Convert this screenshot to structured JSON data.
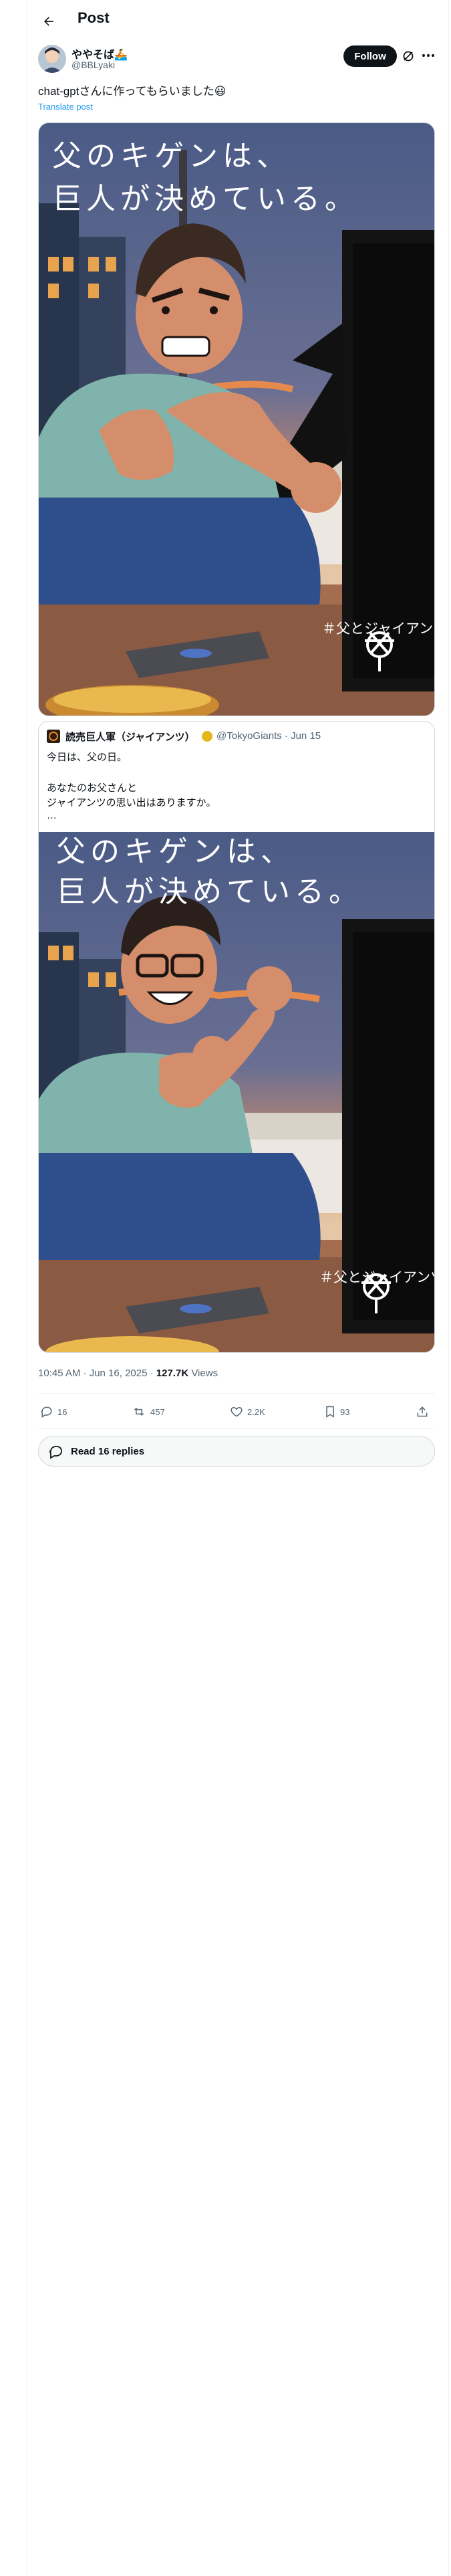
{
  "header": {
    "title": "Post"
  },
  "post": {
    "author": {
      "display_name": "ややそば🚣",
      "handle": "@BBLyaki"
    },
    "follow_label": "Follow",
    "text": "chat-gptさんに作ってもらいました😃",
    "translate_label": "Translate post",
    "image": {
      "caption_line1": "父のキゲンは、",
      "caption_line2": "巨人が決めている。",
      "hashtag": "＃父とジャイアンツ"
    },
    "quote": {
      "author_name": "読売巨人軍（ジャイアンツ）",
      "author_handle": "@TokyoGiants · Jun 15",
      "lines": [
        "今日は、父の日。",
        "あなたのお父さんと",
        "ジャイアンツの思い出はありますか。",
        "…"
      ],
      "image": {
        "caption_line1": "父のキゲンは、",
        "caption_line2": "巨人が決めている。",
        "hashtag": "＃父とジャイアンツ"
      }
    },
    "meta": {
      "timestamp": "10:45 AM · Jun 16, 2025 · ",
      "views_count": "127.7K",
      "views_label": " Views"
    },
    "actions": {
      "replies": "16",
      "reposts": "457",
      "likes": "2.2K",
      "bookmarks": "93"
    },
    "read_replies_label": "Read 16 replies"
  },
  "colors": {
    "accent": "#1d9bf0",
    "follow_bg": "#0f1419",
    "border": "#cfd9de"
  }
}
